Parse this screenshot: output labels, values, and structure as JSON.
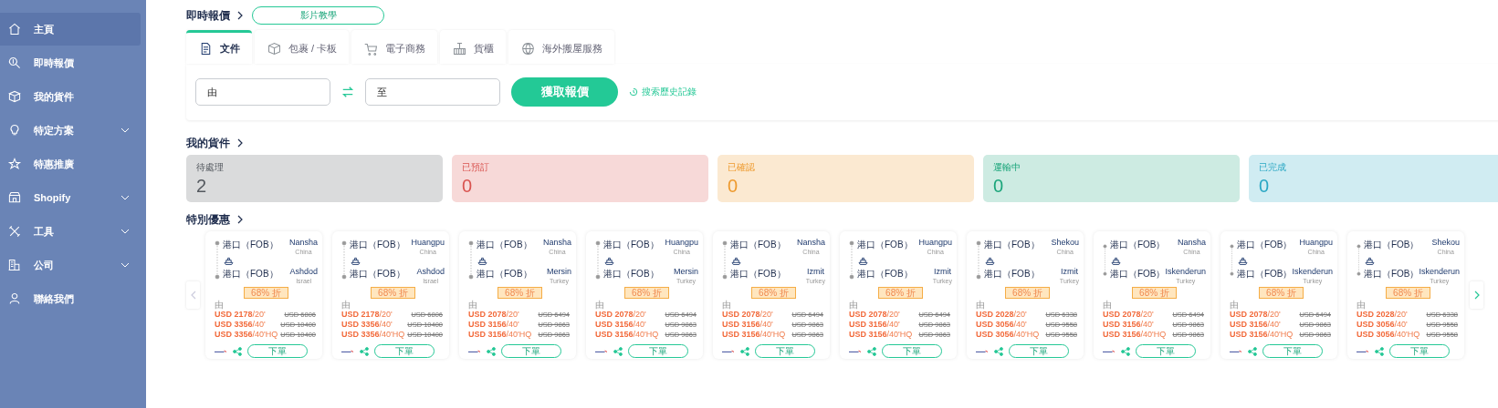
{
  "sidebar": {
    "items": [
      {
        "label": "主頁",
        "selected": true,
        "expandable": false
      },
      {
        "label": "即時報價",
        "selected": false,
        "expandable": false
      },
      {
        "label": "我的貨件",
        "selected": false,
        "expandable": false
      },
      {
        "label": "特定方案",
        "selected": false,
        "expandable": true
      },
      {
        "label": "特惠推廣",
        "selected": false,
        "expandable": false
      },
      {
        "label": "Shopify",
        "selected": false,
        "expandable": true
      },
      {
        "label": "工具",
        "selected": false,
        "expandable": true
      },
      {
        "label": "公司",
        "selected": false,
        "expandable": true
      },
      {
        "label": "聯絡我們",
        "selected": false,
        "expandable": false
      }
    ]
  },
  "quote": {
    "title": "即時報價",
    "video_button": "影片教學",
    "tabs": [
      {
        "label": "文件",
        "selected": true
      },
      {
        "label": "包裹 / 卡板",
        "selected": false
      },
      {
        "label": "電子商務",
        "selected": false
      },
      {
        "label": "貨櫃",
        "selected": false
      },
      {
        "label": "海外搬屋服務",
        "selected": false
      }
    ],
    "from": {
      "placeholder": "由"
    },
    "to": {
      "placeholder": "至"
    },
    "submit": "獲取報價",
    "history_link": "搜索歷史記錄"
  },
  "shipments": {
    "title": "我的貨件",
    "status_cards": [
      {
        "label": "待處理",
        "count": "2",
        "color": "#555a60"
      },
      {
        "label": "已預訂",
        "count": "0",
        "color": "#d9534f"
      },
      {
        "label": "已確認",
        "count": "0",
        "color": "#ee9a2e"
      },
      {
        "label": "運輸中",
        "count": "0",
        "color": "#1aa57a"
      },
      {
        "label": "已完成",
        "count": "0",
        "color": "#2aa7c4"
      }
    ]
  },
  "deals": {
    "title": "特別優惠",
    "cards": [
      {
        "origin_port": "港口（FOB）",
        "origin_city": "Nansha",
        "origin_country": "China",
        "dest_port": "港口（FOB）",
        "dest_city": "Ashdod",
        "dest_country": "Israel",
        "discount": "68% 折",
        "from_label": "由",
        "prices": [
          {
            "amount": "USD 2178",
            "unit": "/20'",
            "old": "USD 6806"
          },
          {
            "amount": "USD 3356",
            "unit": "/40'",
            "old": "USD 10400"
          },
          {
            "amount": "USD 3356",
            "unit": "/40'HQ",
            "old": "USD 10400"
          }
        ],
        "order": "下單"
      },
      {
        "origin_port": "港口（FOB）",
        "origin_city": "Huangpu",
        "origin_country": "China",
        "dest_port": "港口（FOB）",
        "dest_city": "Ashdod",
        "dest_country": "Israel",
        "discount": "68% 折",
        "from_label": "由",
        "prices": [
          {
            "amount": "USD 2178",
            "unit": "/20'",
            "old": "USD 6806"
          },
          {
            "amount": "USD 3356",
            "unit": "/40'",
            "old": "USD 10400"
          },
          {
            "amount": "USD 3356",
            "unit": "/40'HQ",
            "old": "USD 10400"
          }
        ],
        "order": "下單"
      },
      {
        "origin_port": "港口（FOB）",
        "origin_city": "Nansha",
        "origin_country": "China",
        "dest_port": "港口（FOB）",
        "dest_city": "Mersin",
        "dest_country": "Turkey",
        "discount": "68% 折",
        "from_label": "由",
        "prices": [
          {
            "amount": "USD 2078",
            "unit": "/20'",
            "old": "USD 6494"
          },
          {
            "amount": "USD 3156",
            "unit": "/40'",
            "old": "USD 9863"
          },
          {
            "amount": "USD 3156",
            "unit": "/40'HQ",
            "old": "USD 9863"
          }
        ],
        "order": "下單"
      },
      {
        "origin_port": "港口（FOB）",
        "origin_city": "Huangpu",
        "origin_country": "China",
        "dest_port": "港口（FOB）",
        "dest_city": "Mersin",
        "dest_country": "Turkey",
        "discount": "68% 折",
        "from_label": "由",
        "prices": [
          {
            "amount": "USD 2078",
            "unit": "/20'",
            "old": "USD 6494"
          },
          {
            "amount": "USD 3156",
            "unit": "/40'",
            "old": "USD 9863"
          },
          {
            "amount": "USD 3156",
            "unit": "/40'HQ",
            "old": "USD 9863"
          }
        ],
        "order": "下單"
      },
      {
        "origin_port": "港口（FOB）",
        "origin_city": "Nansha",
        "origin_country": "China",
        "dest_port": "港口（FOB）",
        "dest_city": "Izmit",
        "dest_country": "Turkey",
        "discount": "68% 折",
        "from_label": "由",
        "prices": [
          {
            "amount": "USD 2078",
            "unit": "/20'",
            "old": "USD 6494"
          },
          {
            "amount": "USD 3156",
            "unit": "/40'",
            "old": "USD 9863"
          },
          {
            "amount": "USD 3156",
            "unit": "/40'HQ",
            "old": "USD 9863"
          }
        ],
        "order": "下單"
      },
      {
        "origin_port": "港口（FOB）",
        "origin_city": "Huangpu",
        "origin_country": "China",
        "dest_port": "港口（FOB）",
        "dest_city": "Izmit",
        "dest_country": "Turkey",
        "discount": "68% 折",
        "from_label": "由",
        "prices": [
          {
            "amount": "USD 2078",
            "unit": "/20'",
            "old": "USD 6494"
          },
          {
            "amount": "USD 3156",
            "unit": "/40'",
            "old": "USD 9863"
          },
          {
            "amount": "USD 3156",
            "unit": "/40'HQ",
            "old": "USD 9863"
          }
        ],
        "order": "下單"
      },
      {
        "origin_port": "港口（FOB）",
        "origin_city": "Shekou",
        "origin_country": "China",
        "dest_port": "港口（FOB）",
        "dest_city": "Izmit",
        "dest_country": "Turkey",
        "discount": "68% 折",
        "from_label": "由",
        "prices": [
          {
            "amount": "USD 2028",
            "unit": "/20'",
            "old": "USD 6338"
          },
          {
            "amount": "USD 3056",
            "unit": "/40'",
            "old": "USD 9558"
          },
          {
            "amount": "USD 3056",
            "unit": "/40'HQ",
            "old": "USD 9558"
          }
        ],
        "order": "下單"
      },
      {
        "origin_port": "港口（FOB）",
        "origin_city": "Nansha",
        "origin_country": "China",
        "dest_port": "港口（FOB）",
        "dest_city": "Iskenderun",
        "dest_country": "Turkey",
        "discount": "68% 折",
        "from_label": "由",
        "prices": [
          {
            "amount": "USD 2078",
            "unit": "/20'",
            "old": "USD 6494"
          },
          {
            "amount": "USD 3156",
            "unit": "/40'",
            "old": "USD 9863"
          },
          {
            "amount": "USD 3156",
            "unit": "/40'HQ",
            "old": "USD 9863"
          }
        ],
        "order": "下單"
      },
      {
        "origin_port": "港口（FOB）",
        "origin_city": "Huangpu",
        "origin_country": "China",
        "dest_port": "港口（FOB）",
        "dest_city": "Iskenderun",
        "dest_country": "Turkey",
        "discount": "68% 折",
        "from_label": "由",
        "prices": [
          {
            "amount": "USD 2078",
            "unit": "/20'",
            "old": "USD 6494"
          },
          {
            "amount": "USD 3156",
            "unit": "/40'",
            "old": "USD 9863"
          },
          {
            "amount": "USD 3156",
            "unit": "/40'HQ",
            "old": "USD 9863"
          }
        ],
        "order": "下單"
      },
      {
        "origin_port": "港口（FOB）",
        "origin_city": "Shekou",
        "origin_country": "China",
        "dest_port": "港口（FOB）",
        "dest_city": "Iskenderun",
        "dest_country": "Turkey",
        "discount": "68% 折",
        "from_label": "由",
        "prices": [
          {
            "amount": "USD 2028",
            "unit": "/20'",
            "old": "USD 6338"
          },
          {
            "amount": "USD 3056",
            "unit": "/40'",
            "old": "USD 9558"
          },
          {
            "amount": "USD 3056",
            "unit": "/40'HQ",
            "old": "USD 9558"
          }
        ],
        "order": "下單"
      }
    ]
  }
}
